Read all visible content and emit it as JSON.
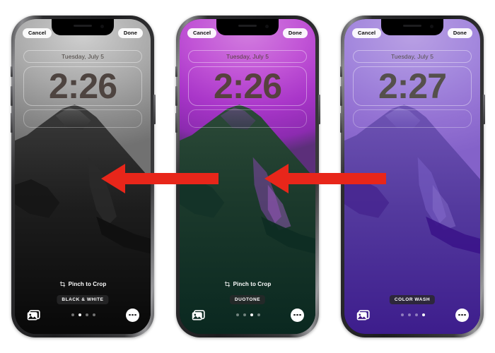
{
  "meta": {
    "title": "iPhone Lock Screen wallpaper style comparison",
    "accent_red": "#e8261a"
  },
  "phones": [
    {
      "id": "phone-black-and-white",
      "cancel_label": "Cancel",
      "done_label": "Done",
      "date_label": "Tuesday, July 5",
      "time_label": "2:26",
      "pinch_label": "Pinch to Crop",
      "style_label": "BLACK & WHITE",
      "pinch_visible": true,
      "dots": {
        "count": 4,
        "active_index": 1
      },
      "photos_icon": "photo-stack-icon",
      "more_icon": "more-ellipsis-icon",
      "colors": {
        "sky": "#a8a8a8",
        "land": "#141414",
        "sea": "#070707"
      }
    },
    {
      "id": "phone-duotone",
      "cancel_label": "Cancel",
      "done_label": "Done",
      "date_label": "Tuesday, July 5",
      "time_label": "2:26",
      "pinch_label": "Pinch to Crop",
      "style_label": "DUOTONE",
      "pinch_visible": true,
      "dots": {
        "count": 4,
        "active_index": 2
      },
      "photos_icon": "photo-stack-icon",
      "more_icon": "more-ellipsis-icon",
      "colors": {
        "sky": "#bb46cf",
        "land": "#1d3a2c",
        "sea": "#0b2a21"
      }
    },
    {
      "id": "phone-color-wash",
      "cancel_label": "Cancel",
      "done_label": "Done",
      "date_label": "Tuesday, July 5",
      "time_label": "2:27",
      "pinch_label": "Pinch to Crop",
      "style_label": "COLOR WASH",
      "pinch_visible": false,
      "dots": {
        "count": 4,
        "active_index": 3
      },
      "photos_icon": "photo-stack-icon",
      "more_icon": "more-ellipsis-icon",
      "colors": {
        "sky": "#a387dd",
        "land": "#5b3fa0",
        "sea": "#390d84"
      }
    }
  ],
  "annotations": {
    "arrows": [
      {
        "name": "arrow-left-1",
        "direction": "left",
        "color": "#e8261a"
      },
      {
        "name": "arrow-left-2",
        "direction": "left",
        "color": "#e8261a"
      }
    ]
  }
}
